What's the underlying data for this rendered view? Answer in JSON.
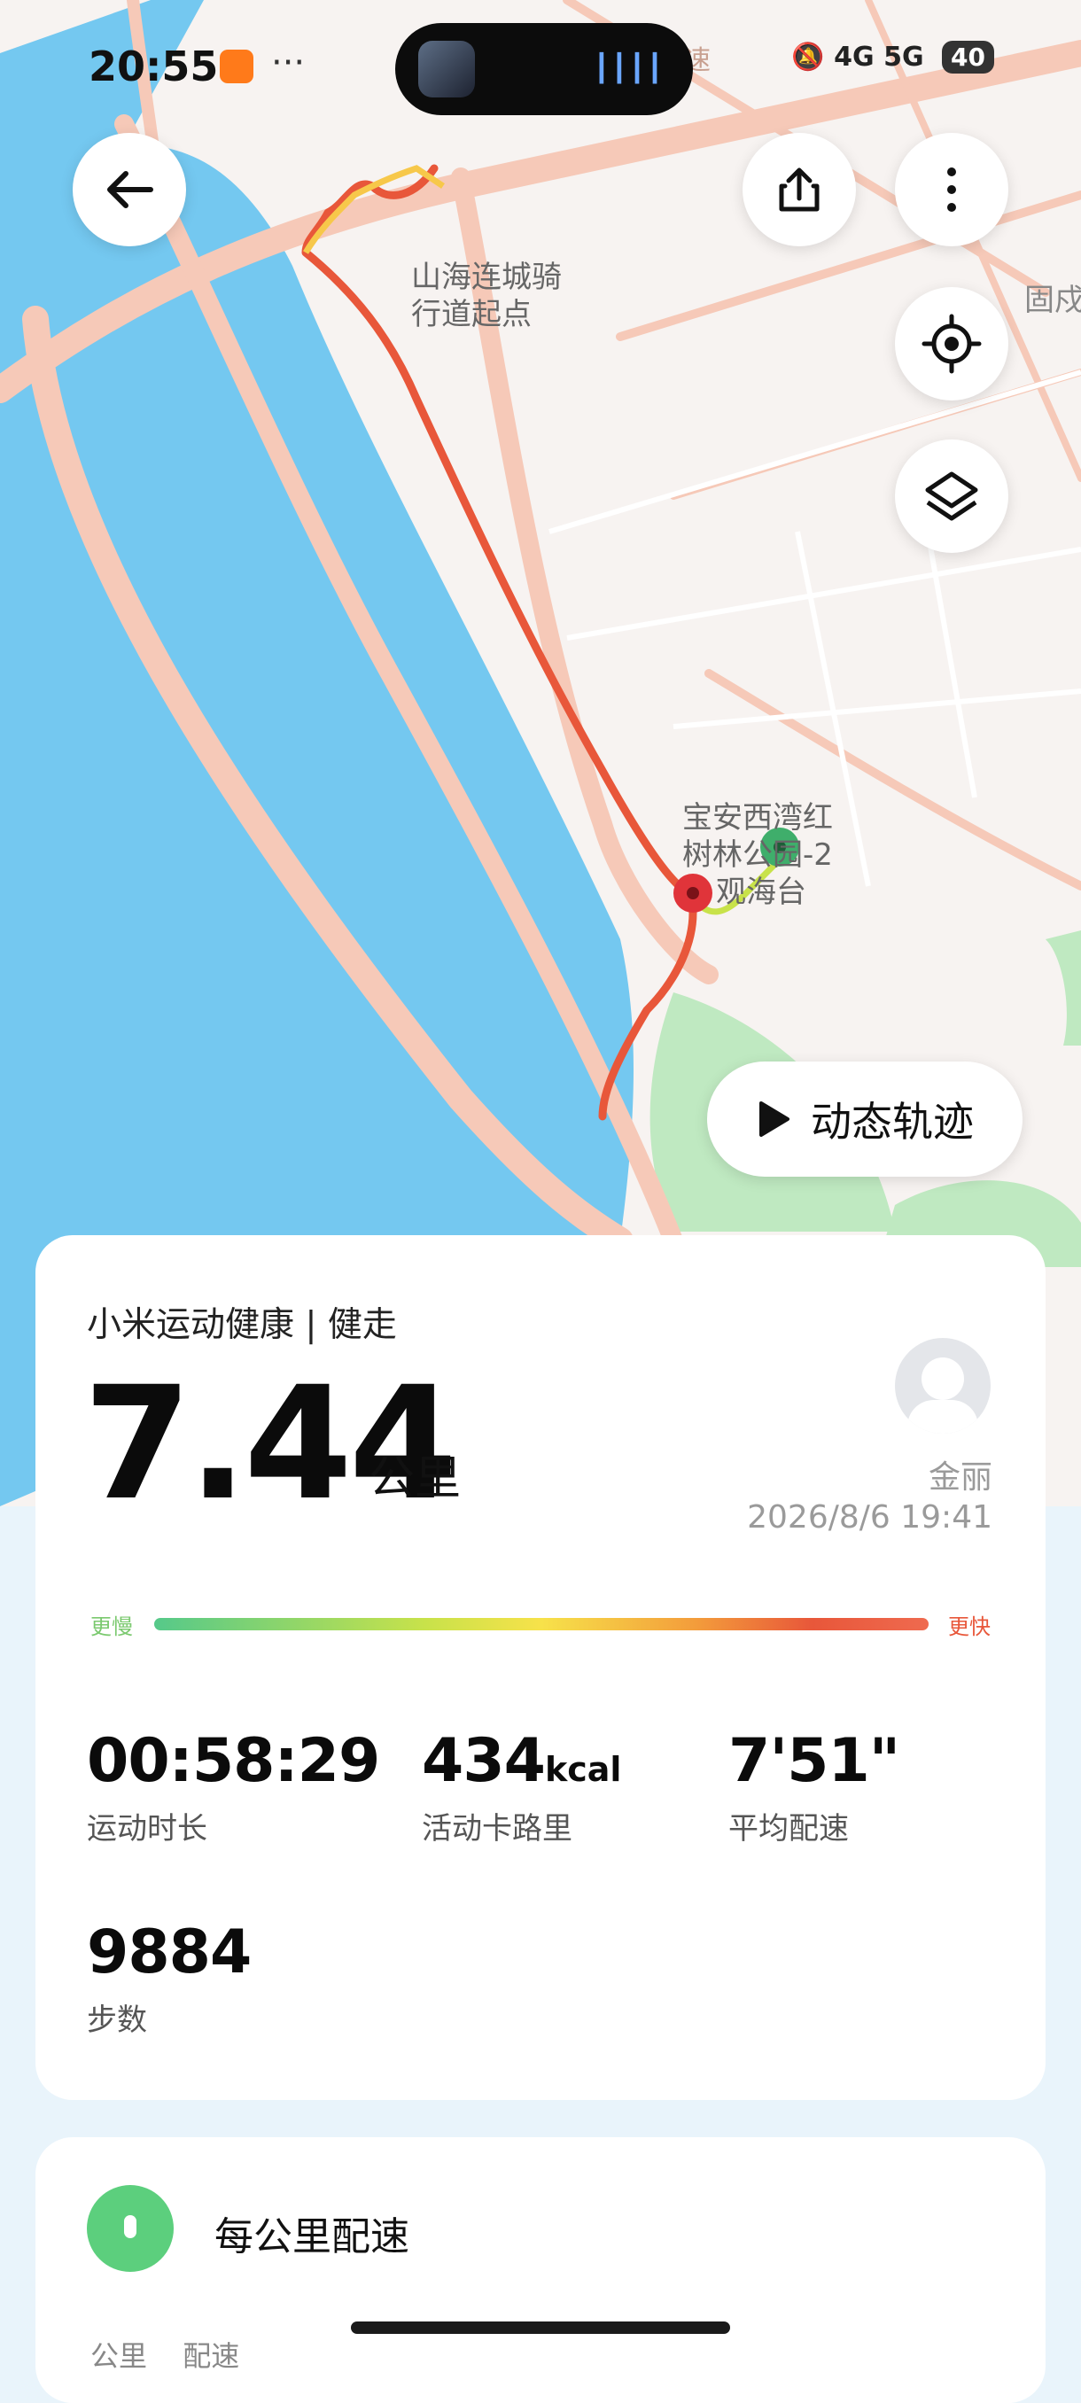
{
  "status_bar": {
    "time": "20:55",
    "more": "···",
    "network": "4G 5G",
    "battery": "40"
  },
  "map": {
    "labels": {
      "start_line1": "山海连城骑",
      "start_line2": "行道起点",
      "poi_line1": "宝安西湾红",
      "poi_line2": "树林公园-2",
      "poi_line3": "观海台",
      "edge_label": "固戍",
      "road_label": "速"
    },
    "colors": {
      "sea": "#74c8f0",
      "land": "#f7f3f1",
      "road": "#f6c9b8",
      "green": "#bfe9c1",
      "route": "#e8573a"
    }
  },
  "buttons": {
    "back_icon": "arrow-left-icon",
    "share_icon": "share-icon",
    "more_icon": "more-vertical-icon",
    "locate_icon": "locate-icon",
    "layers_icon": "layers-icon",
    "dynamic_track_label": "动态轨迹"
  },
  "summary": {
    "app_title": "小米运动健康 | 健走",
    "distance": "7.44",
    "distance_unit": "公里",
    "username": "金丽",
    "datetime": "2026/8/6 19:41",
    "slower_label": "更慢",
    "faster_label": "更快",
    "stats": [
      {
        "value": "00:58:29",
        "unit": "",
        "label": "运动时长"
      },
      {
        "value": "434",
        "unit": "kcal",
        "label": "活动卡路里"
      },
      {
        "value": "7'51\"",
        "unit": "",
        "label": "平均配速"
      },
      {
        "value": "9884",
        "unit": "",
        "label": "步数"
      }
    ]
  },
  "pace_section": {
    "title": "每公里配速",
    "col_km": "公里",
    "col_pace": "配速"
  }
}
